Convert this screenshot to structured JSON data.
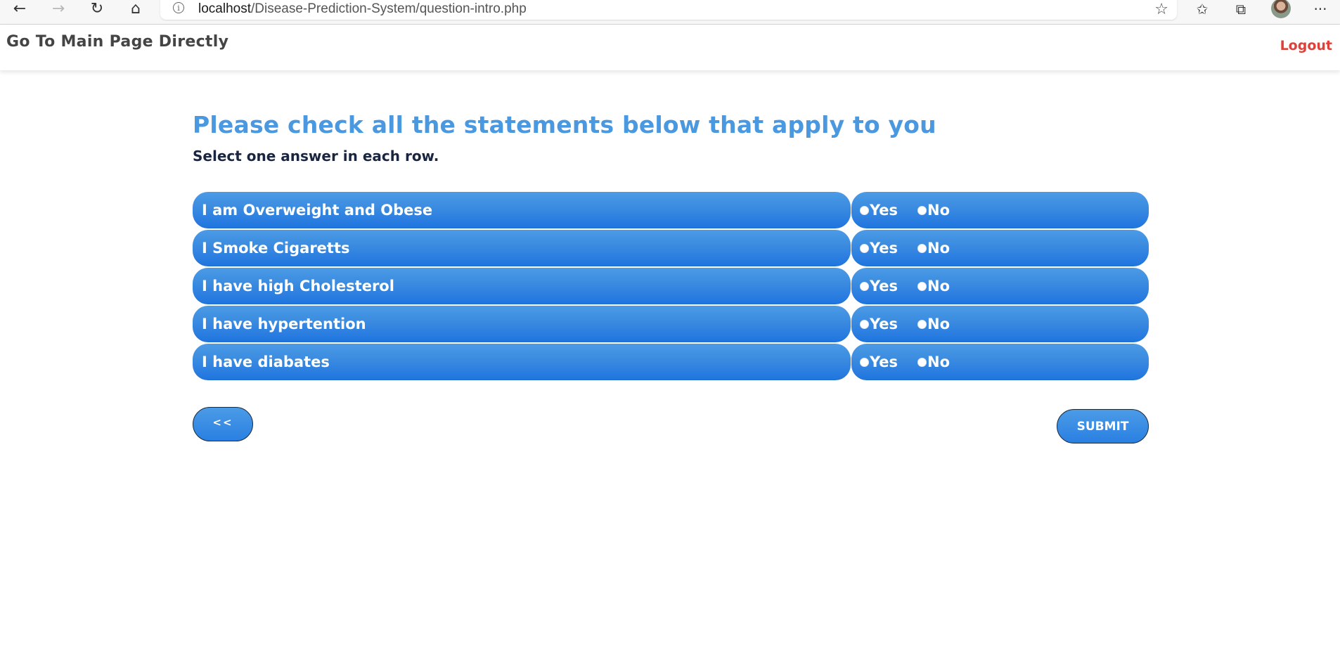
{
  "browser": {
    "url_host": "localhost",
    "url_path": "/Disease-Prediction-System/question-intro.php"
  },
  "header": {
    "home_link": "Go To Main Page Directly",
    "logout": "Logout"
  },
  "main": {
    "title": "Please check all the statements below that apply to you",
    "subtitle": "Select one answer in each row.",
    "questions": [
      {
        "text": "I am Overweight and Obese",
        "yes": "Yes",
        "no": "No"
      },
      {
        "text": "I Smoke Cigaretts",
        "yes": "Yes",
        "no": "No"
      },
      {
        "text": "I have high Cholesterol",
        "yes": "Yes",
        "no": "No"
      },
      {
        "text": "I have hypertention",
        "yes": "Yes",
        "no": "No"
      },
      {
        "text": "I have diabates",
        "yes": "Yes",
        "no": "No"
      }
    ],
    "back_label": "<<",
    "submit_label": "SUBMIT"
  },
  "colors": {
    "accent": "#4a98e0",
    "row_blue": "#2a80e2",
    "logout_red": "#e0403a"
  }
}
